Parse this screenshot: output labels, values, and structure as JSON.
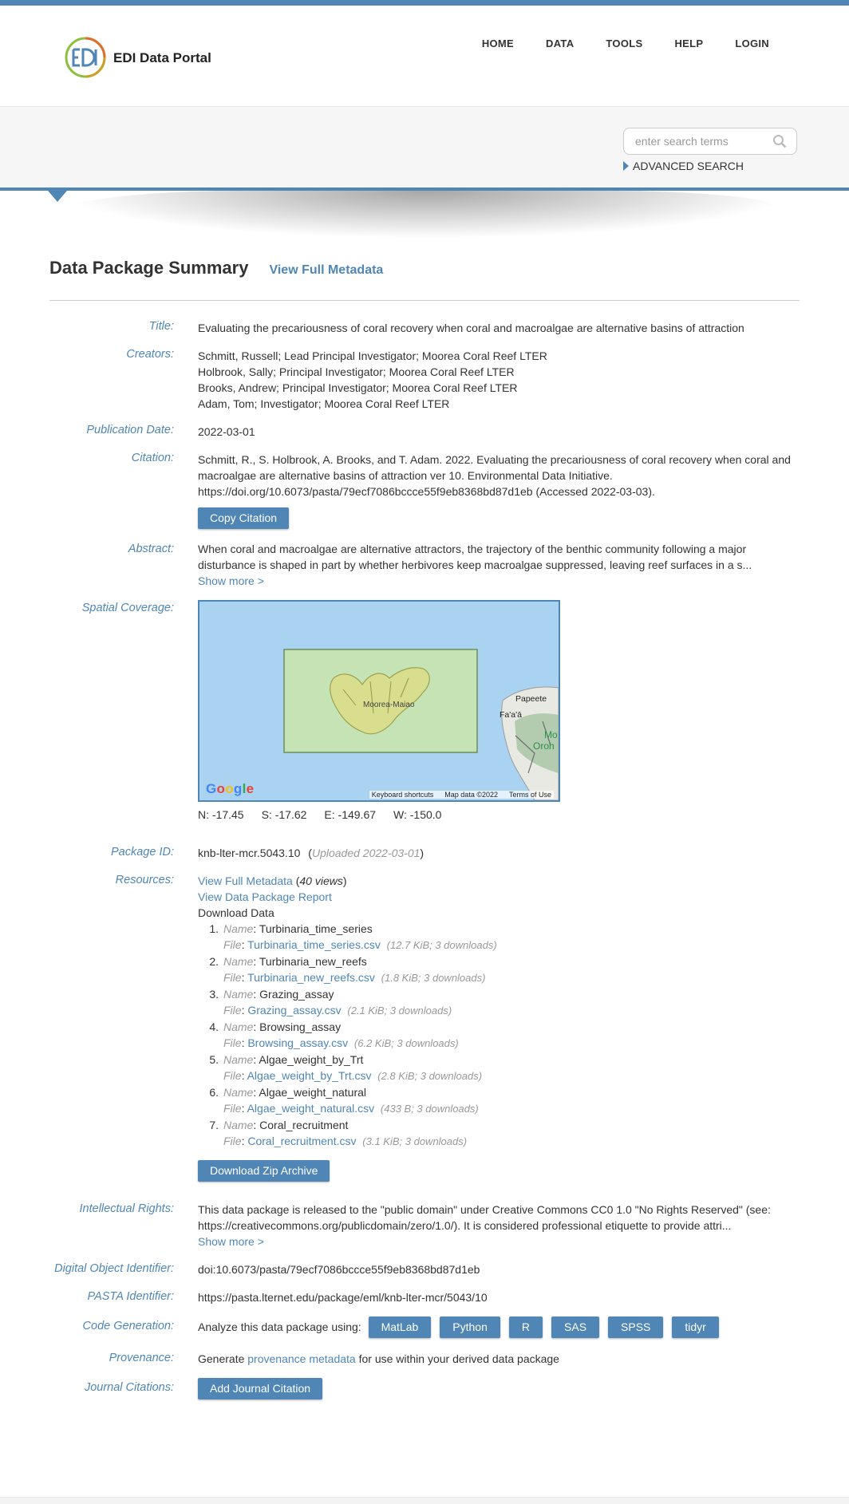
{
  "header": {
    "brand": "EDI Data Portal",
    "logo_text": "EDI",
    "nav": [
      "HOME",
      "DATA",
      "TOOLS",
      "HELP",
      "LOGIN"
    ]
  },
  "search": {
    "placeholder": "enter search terms",
    "advanced": "ADVANCED SEARCH"
  },
  "summary": {
    "heading": "Data Package Summary",
    "view_full_metadata": "View Full Metadata"
  },
  "labels": {
    "title": "Title:",
    "creators": "Creators:",
    "publication_date": "Publication Date:",
    "citation": "Citation:",
    "abstract": "Abstract:",
    "spatial": "Spatial Coverage:",
    "package_id": "Package ID:",
    "resources": "Resources:",
    "rights": "Intellectual Rights:",
    "doi": "Digital Object Identifier:",
    "pasta": "PASTA Identifier:",
    "codegen": "Code Generation:",
    "provenance": "Provenance:",
    "journal": "Journal Citations:"
  },
  "values": {
    "title": "Evaluating the precariousness of coral recovery when coral and macroalgae are alternative basins of attraction",
    "creators": [
      "Schmitt, Russell; Lead Principal Investigator; Moorea Coral Reef LTER",
      "Holbrook, Sally; Principal Investigator; Moorea Coral Reef LTER",
      "Brooks, Andrew; Principal Investigator; Moorea Coral Reef LTER",
      "Adam, Tom; Investigator; Moorea Coral Reef LTER"
    ],
    "publication_date": "2022-03-01",
    "citation_lines": [
      "Schmitt, R., S. Holbrook, A. Brooks, and T. Adam. 2022. Evaluating the precariousness of coral recovery when coral and",
      "macroalgae are alternative basins of attraction ver 10. Environmental Data Initiative.",
      "https://doi.org/10.6073/pasta/79ecf7086bccce55f9eb8368bd87d1eb (Accessed 2022-03-03)."
    ],
    "copy_citation": "Copy Citation",
    "abstract_lines": [
      "When coral and macroalgae are alternative attractors, the trajectory of the benthic community following a major",
      "disturbance is shaped in part by whether herbivores keep macroalgae suppressed, leaving reef surfaces in a s..."
    ],
    "show_more": "Show more >",
    "map": {
      "island_label": "Moorea-Maiao",
      "papeete": "Papeete",
      "faaa": "Fa'a'ā",
      "mo": "Mo",
      "oroh": "Oroh",
      "google": "Google",
      "keyboard": "Keyboard shortcuts",
      "map_data": "Map data ©2022",
      "terms": "Terms of Use"
    },
    "coords": {
      "n": "N: -17.45",
      "s": "S: -17.62",
      "e": "E: -149.67",
      "w": "W: -150.0"
    },
    "package_id": "knb-lter-mcr.5043.10",
    "uploaded_prefix": "(",
    "uploaded": "Uploaded 2022-03-01",
    "uploaded_suffix": ")",
    "resources": {
      "view_full_metadata": "View Full Metadata",
      "views": "40 views",
      "report": "View Data Package Report",
      "download_data": "Download Data",
      "name_label": "Name",
      "file_label": "File",
      "files": [
        {
          "num": "1.",
          "name": "Turbinaria_time_series",
          "file": "Turbinaria_time_series.csv",
          "meta": "(12.7 KiB; 3 downloads)"
        },
        {
          "num": "2.",
          "name": "Turbinaria_new_reefs",
          "file": "Turbinaria_new_reefs.csv",
          "meta": "(1.8 KiB; 3 downloads)"
        },
        {
          "num": "3.",
          "name": "Grazing_assay",
          "file": "Grazing_assay.csv",
          "meta": "(2.1 KiB; 3 downloads)"
        },
        {
          "num": "4.",
          "name": "Browsing_assay",
          "file": "Browsing_assay.csv",
          "meta": "(6.2 KiB; 3 downloads)"
        },
        {
          "num": "5.",
          "name": "Algae_weight_by_Trt",
          "file": "Algae_weight_by_Trt.csv",
          "meta": "(2.8 KiB; 3 downloads)"
        },
        {
          "num": "6.",
          "name": "Algae_weight_natural",
          "file": "Algae_weight_natural.csv",
          "meta": "(433 B; 3 downloads)"
        },
        {
          "num": "7.",
          "name": "Coral_recruitment",
          "file": "Coral_recruitment.csv",
          "meta": "(3.1 KiB; 3 downloads)"
        }
      ],
      "zip": "Download Zip Archive"
    },
    "rights_lines": [
      "This data package is released to the \"public domain\" under Creative Commons CC0 1.0 \"No Rights Reserved\" (see:",
      "https://creativecommons.org/publicdomain/zero/1.0/). It is considered professional etiquette to provide attri..."
    ],
    "doi": "doi:10.6073/pasta/79ecf7086bccce55f9eb8368bd87d1eb",
    "pasta": "https://pasta.lternet.edu/package/eml/knb-lter-mcr/5043/10",
    "codegen_prefix": "Analyze this data package using:",
    "codegen_buttons": [
      "MatLab",
      "Python",
      "R",
      "SAS",
      "SPSS",
      "tidyr"
    ],
    "provenance_prefix": "Generate ",
    "provenance_link": "provenance metadata",
    "provenance_suffix": " for use within your derived data package",
    "journal_button": "Add Journal Citation"
  },
  "colors": {
    "accent": "#4f86b5",
    "map_water": "#aad3f2",
    "map_box": "#c5e3b5"
  }
}
